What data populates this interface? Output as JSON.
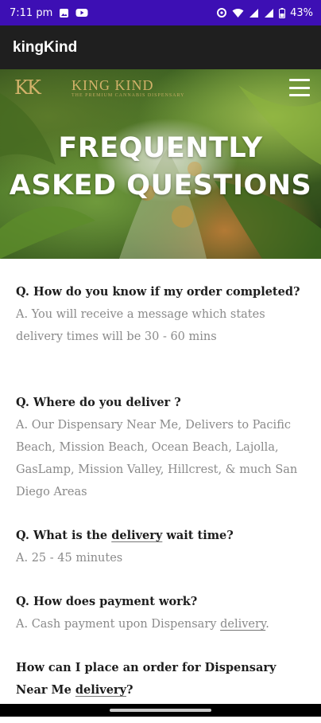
{
  "status_bar": {
    "time": "7:11 pm",
    "battery": "43%",
    "bg_color": "#3d0fb4"
  },
  "app_bar": {
    "title": "kingKind"
  },
  "hero": {
    "logo_mark": "KK",
    "logo_name": "KING KIND",
    "logo_tagline": "THE PREMIUM CANNABIS DISPENSARY",
    "title_line1": "FREQUENTLY",
    "title_line2": "ASKED QUESTIONS"
  },
  "faq": {
    "q1": "Q. How do you know if my order completed?",
    "a1": "A. You will receive a message which states delivery times will be 30 - 60 mins",
    "q2": "Q. Where do you deliver ?",
    "a2": "A. Our Dispensary Near Me, Delivers to Pacific Beach, Mission Beach, Ocean Beach, Lajolla, GasLamp, Mission Valley, Hillcrest, & much San Diego Areas",
    "q3_prefix": "Q. What is the ",
    "q3_link": "delivery",
    "q3_suffix": " wait time?",
    "a3": "A. 25 - 45 minutes",
    "q4": "Q. How does payment work?",
    "a4_prefix": "A. Cash payment upon Dispensary ",
    "a4_link": "delivery",
    "a4_suffix": ".",
    "q5_prefix": "How can I place an order for Dispensary Near Me ",
    "q5_link": "delivery",
    "q5_suffix": "?"
  }
}
